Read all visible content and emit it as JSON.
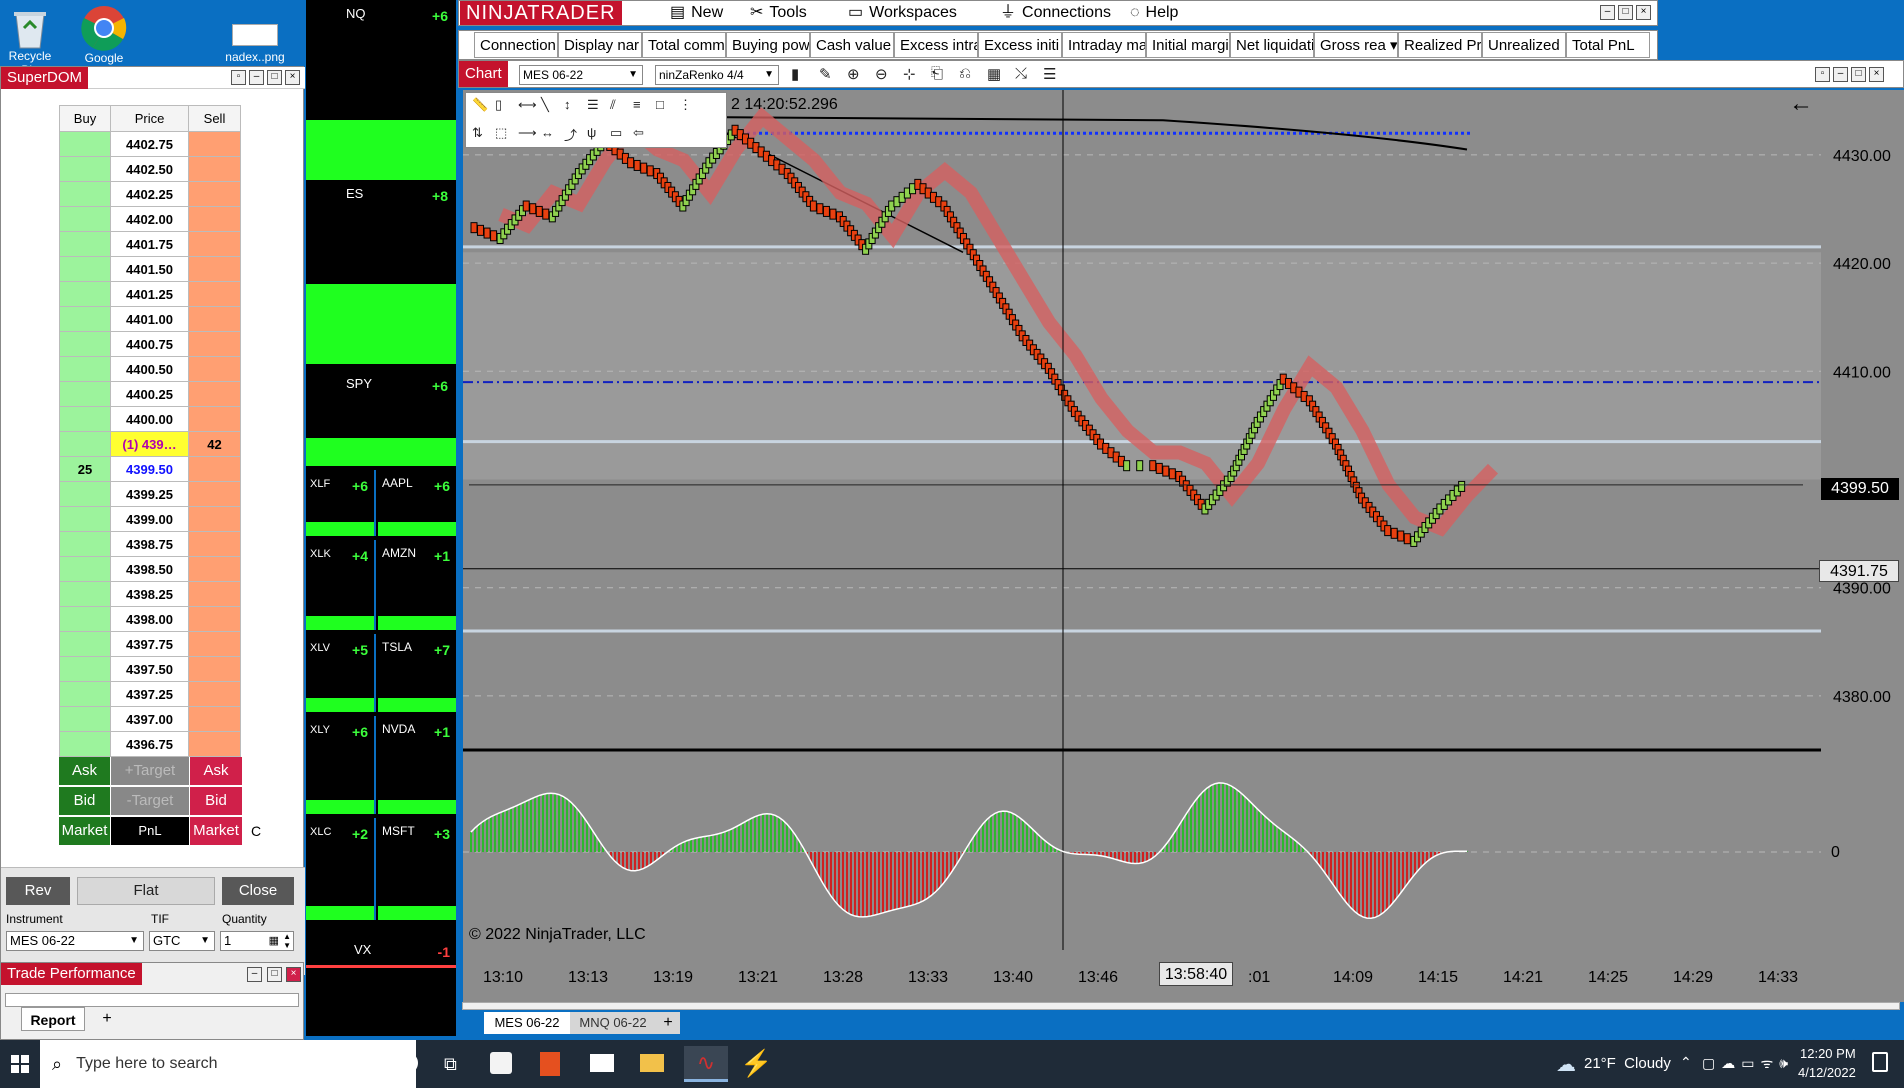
{
  "desktop": {
    "icons": [
      {
        "label": "Recycle Bin"
      },
      {
        "label": "Google"
      },
      {
        "label": "nadex..png"
      }
    ]
  },
  "superdom": {
    "title": "SuperDOM",
    "headers": {
      "buy": "Buy",
      "price": "Price",
      "sell": "Sell"
    },
    "rows": [
      {
        "buy": "",
        "price": "4402.75",
        "sell": ""
      },
      {
        "buy": "",
        "price": "4402.50",
        "sell": ""
      },
      {
        "buy": "",
        "price": "4402.25",
        "sell": ""
      },
      {
        "buy": "",
        "price": "4402.00",
        "sell": ""
      },
      {
        "buy": "",
        "price": "4401.75",
        "sell": ""
      },
      {
        "buy": "",
        "price": "4401.50",
        "sell": ""
      },
      {
        "buy": "",
        "price": "4401.25",
        "sell": ""
      },
      {
        "buy": "",
        "price": "4401.00",
        "sell": ""
      },
      {
        "buy": "",
        "price": "4400.75",
        "sell": ""
      },
      {
        "buy": "",
        "price": "4400.50",
        "sell": ""
      },
      {
        "buy": "",
        "price": "4400.25",
        "sell": ""
      },
      {
        "buy": "",
        "price": "4400.00",
        "sell": ""
      },
      {
        "buy": "",
        "price": "(1) 439…",
        "sell": "42",
        "highlight": "position"
      },
      {
        "buy": "25",
        "price": "4399.50",
        "sell": "",
        "highlight": "last"
      },
      {
        "buy": "",
        "price": "4399.25",
        "sell": ""
      },
      {
        "buy": "",
        "price": "4399.00",
        "sell": ""
      },
      {
        "buy": "",
        "price": "4398.75",
        "sell": ""
      },
      {
        "buy": "",
        "price": "4398.50",
        "sell": ""
      },
      {
        "buy": "",
        "price": "4398.25",
        "sell": ""
      },
      {
        "buy": "",
        "price": "4398.00",
        "sell": ""
      },
      {
        "buy": "",
        "price": "4397.75",
        "sell": ""
      },
      {
        "buy": "",
        "price": "4397.50",
        "sell": ""
      },
      {
        "buy": "",
        "price": "4397.25",
        "sell": ""
      },
      {
        "buy": "",
        "price": "4397.00",
        "sell": ""
      },
      {
        "buy": "",
        "price": "4396.75",
        "sell": ""
      }
    ],
    "ask_label": "Ask",
    "bid_label": "Bid",
    "market_label": "Market",
    "plus_target": "+Target",
    "minus_target": "-Target",
    "pnl_label": "PnL",
    "c_label": "C",
    "rev_label": "Rev",
    "flat_label": "Flat",
    "close_label": "Close",
    "instrument_label": "Instrument",
    "instrument_value": "MES 06-22",
    "tif_label": "TIF",
    "tif_value": "GTC",
    "quantity_label": "Quantity",
    "quantity_value": "1"
  },
  "trade_performance": {
    "title": "Trade Performance",
    "tab": "Report",
    "add": "+"
  },
  "heat": {
    "big": [
      {
        "sym": "NQ",
        "val": "+6"
      },
      {
        "sym": "ES",
        "val": "+8"
      },
      {
        "sym": "SPY",
        "val": "+6"
      }
    ],
    "left": [
      {
        "sym": "XLF",
        "val": "+6"
      },
      {
        "sym": "XLK",
        "val": "+4"
      },
      {
        "sym": "XLV",
        "val": "+5"
      },
      {
        "sym": "XLY",
        "val": "+6"
      },
      {
        "sym": "XLC",
        "val": "+2"
      }
    ],
    "right": [
      {
        "sym": "AAPL",
        "val": "+6"
      },
      {
        "sym": "AMZN",
        "val": "+1"
      },
      {
        "sym": "TSLA",
        "val": "+7"
      },
      {
        "sym": "NVDA",
        "val": "+1"
      },
      {
        "sym": "MSFT",
        "val": "+3"
      }
    ],
    "vx": {
      "sym": "VX",
      "val": "-1"
    }
  },
  "ninja": {
    "logo": "NINJATRADER",
    "menu": [
      {
        "label": "New",
        "icon": "new-icon"
      },
      {
        "label": "Tools",
        "icon": "tools-icon"
      },
      {
        "label": "Workspaces",
        "icon": "workspaces-icon"
      },
      {
        "label": "Connections",
        "icon": "connections-icon"
      },
      {
        "label": "Help",
        "icon": "help-icon"
      }
    ],
    "account_cols": [
      "Connection",
      "Display nar",
      "Total comm",
      "Buying pow",
      "Cash value",
      "Excess intra",
      "Excess initi",
      "Intraday ma",
      "Initial margi",
      "Net liquidati",
      "Gross rea ▾",
      "Realized Pr",
      "Unrealized I",
      "Total PnL"
    ],
    "chart_tab": "Chart",
    "instrument_select": "MES 06-22",
    "bartype_select": "ninZaRenko 4/4",
    "timestamp": "2 14:20:52.296",
    "copyright": "© 2022 NinjaTrader, LLC",
    "price_marker": "4399.50",
    "cursor_price": "4391.75",
    "cursor_time": "13:58:40",
    "osc_zero": "0",
    "bottom_tabs": [
      "MES 06-22",
      "MNQ 06-22"
    ],
    "bottom_add": "+"
  },
  "chart_data": {
    "type": "line",
    "title": "",
    "y_ticks": [
      4380,
      4390,
      4400,
      4410,
      4420,
      4430
    ],
    "y_tick_labels": [
      "4380.00",
      "4390.00",
      "4410.00",
      "4420.00",
      "4430.00"
    ],
    "x_tick_labels": [
      "13:10",
      "13:13",
      "13:19",
      "13:21",
      "13:28",
      "13:33",
      "13:40",
      "13:46",
      "13:",
      ":01",
      "14:09",
      "14:15",
      "14:21",
      "14:25",
      "14:29",
      "14:33"
    ],
    "ylim": [
      4375,
      4436
    ],
    "series": [
      {
        "values": [
          4423,
          4422,
          4425,
          4424,
          4428,
          4431,
          4429,
          4428,
          4425,
          4429,
          4432,
          4430,
          4428,
          4425,
          4424,
          4421,
          4425,
          4427,
          4425,
          4421,
          4417,
          4413,
          4410,
          4406,
          4403,
          4401,
          4401,
          4400,
          4397,
          4400,
          4405,
          4409,
          4407,
          4403,
          4398,
          4395,
          4394,
          4397,
          4399.5
        ]
      }
    ],
    "lines": [
      {
        "name": "",
        "value": 4432,
        "style": "dotted-blue"
      },
      {
        "name": "",
        "value": 4409,
        "style": "dashdot-blue"
      }
    ]
  },
  "taskbar": {
    "search_placeholder": "Type here to search",
    "weather": "21°F  Cloudy",
    "time": "12:20 PM",
    "date": "4/12/2022"
  }
}
